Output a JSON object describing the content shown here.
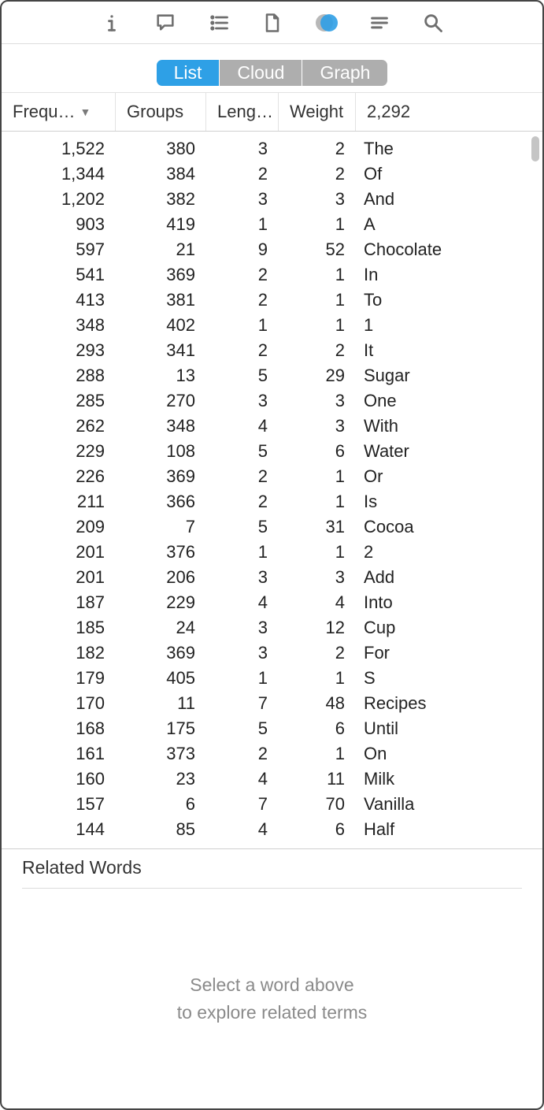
{
  "toolbar_icons": [
    "info-icon",
    "comment-icon",
    "list-icon",
    "document-icon",
    "concordance-icon",
    "paragraph-icon",
    "search-icon"
  ],
  "segmented": {
    "items": [
      "List",
      "Cloud",
      "Graph"
    ],
    "active_index": 0
  },
  "table": {
    "headers": {
      "frequency": "Frequ…",
      "groups": "Groups",
      "length": "Leng…",
      "weight": "Weight",
      "word": "2,292"
    },
    "sort_column": "frequency",
    "sort_direction": "desc",
    "rows": [
      {
        "frequency": "1,522",
        "groups": "380",
        "length": "3",
        "weight": "2",
        "word": "The"
      },
      {
        "frequency": "1,344",
        "groups": "384",
        "length": "2",
        "weight": "2",
        "word": "Of"
      },
      {
        "frequency": "1,202",
        "groups": "382",
        "length": "3",
        "weight": "3",
        "word": "And"
      },
      {
        "frequency": "903",
        "groups": "419",
        "length": "1",
        "weight": "1",
        "word": "A"
      },
      {
        "frequency": "597",
        "groups": "21",
        "length": "9",
        "weight": "52",
        "word": "Chocolate"
      },
      {
        "frequency": "541",
        "groups": "369",
        "length": "2",
        "weight": "1",
        "word": "In"
      },
      {
        "frequency": "413",
        "groups": "381",
        "length": "2",
        "weight": "1",
        "word": "To"
      },
      {
        "frequency": "348",
        "groups": "402",
        "length": "1",
        "weight": "1",
        "word": "1"
      },
      {
        "frequency": "293",
        "groups": "341",
        "length": "2",
        "weight": "2",
        "word": "It"
      },
      {
        "frequency": "288",
        "groups": "13",
        "length": "5",
        "weight": "29",
        "word": "Sugar"
      },
      {
        "frequency": "285",
        "groups": "270",
        "length": "3",
        "weight": "3",
        "word": "One"
      },
      {
        "frequency": "262",
        "groups": "348",
        "length": "4",
        "weight": "3",
        "word": "With"
      },
      {
        "frequency": "229",
        "groups": "108",
        "length": "5",
        "weight": "6",
        "word": "Water"
      },
      {
        "frequency": "226",
        "groups": "369",
        "length": "2",
        "weight": "1",
        "word": "Or"
      },
      {
        "frequency": "211",
        "groups": "366",
        "length": "2",
        "weight": "1",
        "word": "Is"
      },
      {
        "frequency": "209",
        "groups": "7",
        "length": "5",
        "weight": "31",
        "word": "Cocoa"
      },
      {
        "frequency": "201",
        "groups": "376",
        "length": "1",
        "weight": "1",
        "word": "2"
      },
      {
        "frequency": "201",
        "groups": "206",
        "length": "3",
        "weight": "3",
        "word": "Add"
      },
      {
        "frequency": "187",
        "groups": "229",
        "length": "4",
        "weight": "4",
        "word": "Into"
      },
      {
        "frequency": "185",
        "groups": "24",
        "length": "3",
        "weight": "12",
        "word": "Cup"
      },
      {
        "frequency": "182",
        "groups": "369",
        "length": "3",
        "weight": "2",
        "word": "For"
      },
      {
        "frequency": "179",
        "groups": "405",
        "length": "1",
        "weight": "1",
        "word": "S"
      },
      {
        "frequency": "170",
        "groups": "11",
        "length": "7",
        "weight": "48",
        "word": "Recipes"
      },
      {
        "frequency": "168",
        "groups": "175",
        "length": "5",
        "weight": "6",
        "word": "Until"
      },
      {
        "frequency": "161",
        "groups": "373",
        "length": "2",
        "weight": "1",
        "word": "On"
      },
      {
        "frequency": "160",
        "groups": "23",
        "length": "4",
        "weight": "11",
        "word": "Milk"
      },
      {
        "frequency": "157",
        "groups": "6",
        "length": "7",
        "weight": "70",
        "word": "Vanilla"
      },
      {
        "frequency": "144",
        "groups": "85",
        "length": "4",
        "weight": "6",
        "word": "Half"
      }
    ]
  },
  "related": {
    "title": "Related Words",
    "empty_line1": "Select a word above",
    "empty_line2": "to explore related terms"
  }
}
